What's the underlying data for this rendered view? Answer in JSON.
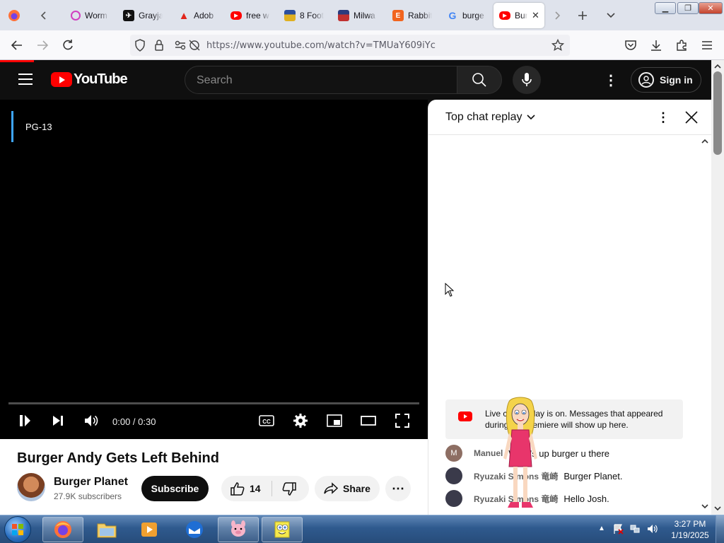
{
  "browser": {
    "tabs": [
      {
        "label": "Worm",
        "icon": "worm-favicon-icon"
      },
      {
        "label": "Grayja",
        "icon": "grayjay-favicon-icon"
      },
      {
        "label": "Adob",
        "icon": "adobe-favicon-icon"
      },
      {
        "label": "free w",
        "icon": "youtube-favicon-icon"
      },
      {
        "label": "8 Foot",
        "icon": "store-favicon-icon"
      },
      {
        "label": "Milwa",
        "icon": "store-favicon-icon"
      },
      {
        "label": "Rabbit",
        "icon": "etsy-favicon-icon"
      },
      {
        "label": "burge",
        "icon": "google-favicon-icon"
      },
      {
        "label": "Bur",
        "icon": "youtube-favicon-icon",
        "active": true
      }
    ],
    "url": "https://www.youtube.com/watch?v=TMUaY609iYc"
  },
  "youtube": {
    "logo_text": "YouTube",
    "search_placeholder": "Search",
    "sign_in": "Sign in",
    "video": {
      "rating": "PG-13",
      "time": "0:00 / 0:30",
      "progress": 0
    },
    "title": "Burger Andy Gets Left Behind",
    "channel": {
      "name": "Burger Planet",
      "subscribers": "27.9K subscribers",
      "subscribe_label": "Subscribe"
    },
    "likes": "14",
    "share_label": "Share"
  },
  "chat": {
    "title": "Top chat replay",
    "notice": "Live chat replay is on. Messages that appeared during the premiere will show up here.",
    "messages": [
      {
        "author": "Manuel",
        "initial": "M",
        "text": "What's up burger u there",
        "avatar_color": "#8d6e63"
      },
      {
        "author": "Ryuzaki Simons 竜崎",
        "initial": "",
        "text": "Burger Planet.",
        "avatar_color": "#3a3a4a"
      },
      {
        "author": "Ryuzaki Simons 竜崎",
        "initial": "",
        "text": "Hello Josh.",
        "avatar_color": "#3a3a4a"
      }
    ]
  },
  "taskbar": {
    "time": "3:27 PM",
    "date": "1/19/2025",
    "apps": [
      "firefox-icon",
      "file-explorer-icon",
      "media-player-icon",
      "thunderbird-icon",
      "piglet-icon",
      "spongebob-icon"
    ]
  },
  "colors": {
    "youtube_red": "#ff0000",
    "accent_blue": "#3ea6ff"
  }
}
